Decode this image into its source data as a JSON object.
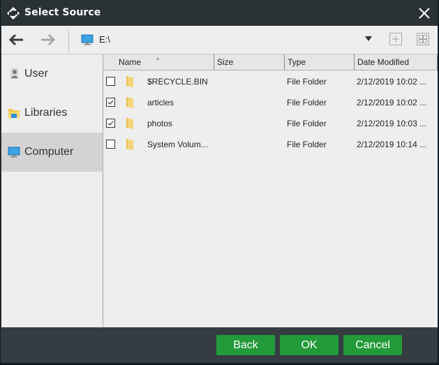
{
  "window": {
    "title": "Select Source",
    "icon": "transfer-arrows-icon",
    "close_icon": "close-icon"
  },
  "toolbar": {
    "back_icon": "arrow-left-icon",
    "forward_icon": "arrow-right-icon",
    "path_icon": "computer-monitor-icon",
    "path": "E:\\",
    "dropdown_icon": "caret-down-icon",
    "new_folder_icon": "plus-box-icon",
    "view_icon": "grid-view-icon"
  },
  "sidebar": {
    "items": [
      {
        "label": "User",
        "icon": "user-icon",
        "active": false
      },
      {
        "label": "Libraries",
        "icon": "libraries-icon",
        "active": false
      },
      {
        "label": "Computer",
        "icon": "computer-icon",
        "active": true
      }
    ]
  },
  "filelist": {
    "columns": [
      "Name",
      "Size",
      "Type",
      "Date Modified"
    ],
    "sort_column": "Name",
    "rows": [
      {
        "checked": false,
        "name": "$RECYCLE.BIN",
        "size": "",
        "type": "File Folder",
        "date": "2/12/2019 10:02 ..."
      },
      {
        "checked": true,
        "name": "articles",
        "size": "",
        "type": "File Folder",
        "date": "2/12/2019 10:02 ..."
      },
      {
        "checked": true,
        "name": "photos",
        "size": "",
        "type": "File Folder",
        "date": "2/12/2019 10:03 ..."
      },
      {
        "checked": false,
        "name": "System Volum...",
        "size": "",
        "type": "File Folder",
        "date": "2/12/2019 10:14 ..."
      }
    ]
  },
  "footer": {
    "back_label": "Back",
    "ok_label": "OK",
    "cancel_label": "Cancel"
  },
  "colors": {
    "accent_button": "#239a3a",
    "titlebar": "#2b3236",
    "footer": "#353d42"
  }
}
